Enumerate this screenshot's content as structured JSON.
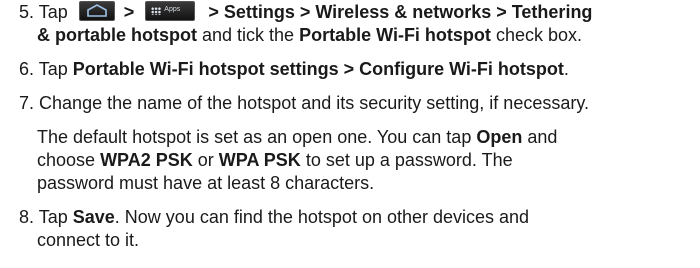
{
  "steps": [
    {
      "num": "5.",
      "tap": "Tap",
      "sep1": ">",
      "apps_icon_label": "Apps",
      "path": "> Settings > Wireless & networks > Tethering",
      "path_cont": "& portable hotspot",
      "mid": "and tick the",
      "bold2": "Portable Wi-Fi hotspot",
      "end": "check box."
    },
    {
      "num": "6.",
      "tap": "Tap",
      "bold": "Portable Wi-Fi hotspot settings > Configure Wi-Fi hotspot",
      "end": "."
    },
    {
      "num": "7.",
      "text": "Change the name of the hotspot and its security setting, if necessary.",
      "para_a": "The default hotspot is set as an open one. You can tap",
      "para_open": "Open",
      "para_and": "and",
      "para_choose": "choose",
      "para_wpa2": "WPA2 PSK",
      "para_or": "or",
      "para_wpa": "WPA PSK",
      "para_b": "to set up a password. The",
      "para_c": "password must have at least 8 characters."
    },
    {
      "num": "8.",
      "tap": "Tap",
      "bold": "Save",
      "rest": ". Now you can find the hotspot on other devices and",
      "rest2": "connect to it."
    }
  ],
  "icons": [
    "home-icon",
    "apps-icon"
  ]
}
